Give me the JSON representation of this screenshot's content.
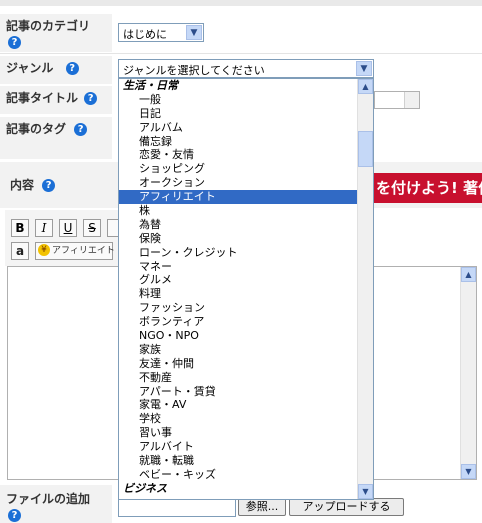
{
  "form": {
    "category_label": "記事のカテゴリ",
    "category_value": "はじめに",
    "genre_label": "ジャンル",
    "genre_placeholder": "ジャンルを選択してください",
    "title_label": "記事タイトル",
    "tags_label": "記事のタグ",
    "content_label": "内容",
    "file_label": "ファイルの追加",
    "browse_button": "参照...",
    "upload_button": "アップロードする",
    "help_glyph": "?"
  },
  "toolbar": {
    "bold": "B",
    "italic": "I",
    "underline": "U",
    "strike": "S",
    "amazon": "a",
    "affiliate_label": "アフィリエイト"
  },
  "banner_text": "を付けよう! 著作",
  "genre_options": [
    {
      "label": "生活・日常",
      "group": true
    },
    {
      "label": "一般"
    },
    {
      "label": "日記"
    },
    {
      "label": "アルバム"
    },
    {
      "label": "備忘録"
    },
    {
      "label": "恋愛・友情"
    },
    {
      "label": "ショッピング"
    },
    {
      "label": "オークション"
    },
    {
      "label": "アフィリエイト",
      "selected": true
    },
    {
      "label": "株"
    },
    {
      "label": "為替"
    },
    {
      "label": "保険"
    },
    {
      "label": "ローン・クレジット"
    },
    {
      "label": "マネー"
    },
    {
      "label": "グルメ"
    },
    {
      "label": "料理"
    },
    {
      "label": "ファッション"
    },
    {
      "label": "ボランティア"
    },
    {
      "label": "NGO・NPO"
    },
    {
      "label": "家族"
    },
    {
      "label": "友達・仲間"
    },
    {
      "label": "不動産"
    },
    {
      "label": "アパート・賃貸"
    },
    {
      "label": "家電・AV"
    },
    {
      "label": "学校"
    },
    {
      "label": "習い事"
    },
    {
      "label": "アルバイト"
    },
    {
      "label": "就職・転職"
    },
    {
      "label": "ベビー・キッズ"
    },
    {
      "label": "ビジネス",
      "group": true
    }
  ]
}
